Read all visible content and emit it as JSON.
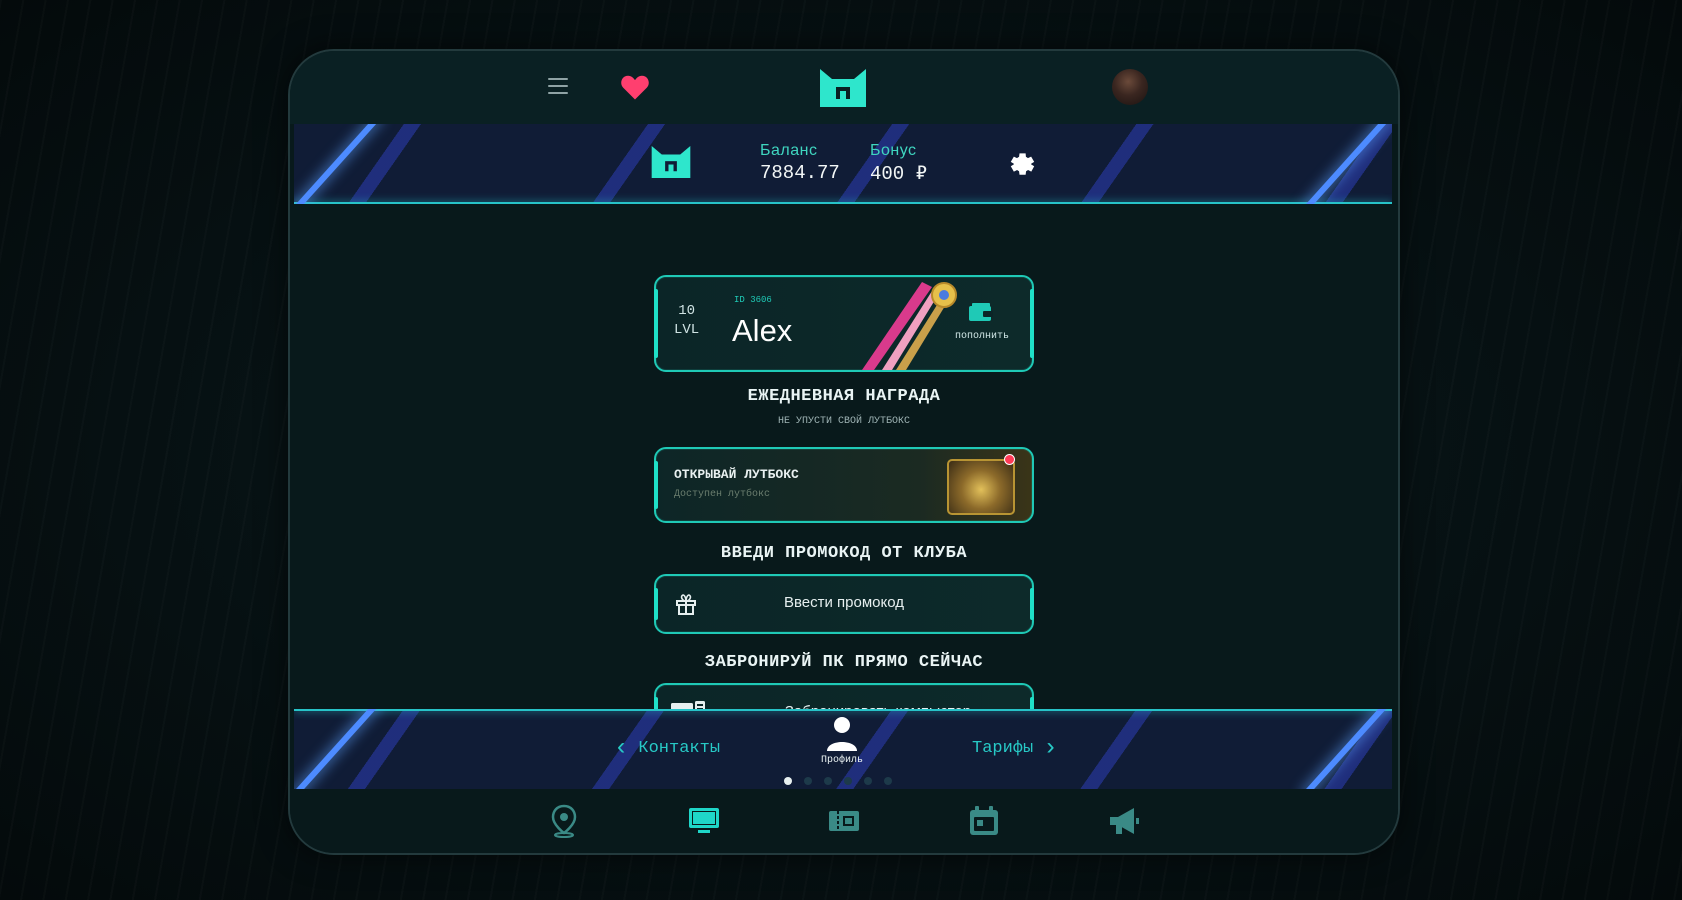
{
  "header": {
    "menu_icon": "hamburger-icon",
    "favorite_icon": "heart-icon",
    "logo_icon": "brand-logo-icon",
    "avatar_icon": "user-avatar"
  },
  "balance_bar": {
    "balance_label": "Баланс",
    "balance_value": "7884.77",
    "bonus_label": "Бонус",
    "bonus_value": "400 ₽",
    "settings_icon": "gear-icon"
  },
  "profile_card": {
    "level_number": "10",
    "level_unit": "LVL",
    "id_tag": "ID 3606",
    "player_name": "Alex",
    "topup_label": "пополнить",
    "topup_icon": "wallet-icon"
  },
  "daily_reward": {
    "heading": "ЕЖЕДНЕВНАЯ НАГРАДА",
    "subheading": "НЕ УПУСТИ СВОЙ ЛУТБОКС",
    "card_title": "ОТКРЫВАЙ ЛУТБОКС",
    "card_subtitle": "Доступен лутбокс"
  },
  "promo": {
    "heading": "ВВЕДИ ПРОМОКОД ОТ КЛУБА",
    "button_label": "Ввести промокод"
  },
  "booking": {
    "heading": "ЗАБРОНИРУЙ ПК ПРЯМО СЕЙЧАС",
    "button_label": "Забронировать компьютер"
  },
  "carousel_nav": {
    "prev_label": "Контакты",
    "current_label": "Профиль",
    "next_label": "Тарифы",
    "page_count": 6,
    "active_page": 1
  },
  "tabbar": {
    "tabs": [
      "map-pin-icon",
      "monitor-icon",
      "ticket-icon",
      "calendar-icon",
      "megaphone-icon"
    ],
    "active_tab": "monitor-icon"
  },
  "colors": {
    "accent": "#1fc9b6",
    "banner_blue": "#4d8bff",
    "notification": "#ff3b57"
  }
}
